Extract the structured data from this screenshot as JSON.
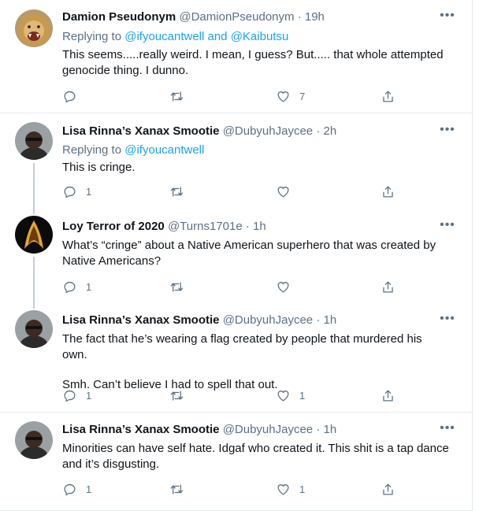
{
  "tweets": [
    {
      "name": "Damion Pseudonym",
      "handle": "@DamionPseudonym",
      "sep": "·",
      "time": "19h",
      "more": "•••",
      "replying_prefix": "Replying to ",
      "replying_to_1": "@ifyoucantwell",
      "replying_and": " and ",
      "replying_to_2": "@Kaibutsu",
      "text_line1": "This seems.....really weird. I mean, I guess? But..... that whole attempted",
      "text_line2": "genocide thing. I dunno.",
      "likes": "7"
    },
    {
      "name": "Lisa Rinna’s Xanax Smootie",
      "handle": "@DubyuhJaycee",
      "sep": "·",
      "time": "2h",
      "more": "•••",
      "replying_prefix": "Replying to ",
      "replying_to_1": "@ifyoucantwell",
      "text_line1": "This is cringe.",
      "replies": "1"
    },
    {
      "name": "Loy Terror of 2020",
      "handle": "@Turns1701e",
      "sep": "·",
      "time": "1h",
      "more": "•••",
      "text_line1": "What’s “cringe” about a Native American superhero that was created by",
      "text_line2": "Native Americans?",
      "replies": "1"
    },
    {
      "name": "Lisa Rinna’s Xanax Smootie",
      "handle": "@DubyuhJaycee",
      "sep": "·",
      "time": "1h",
      "more": "•••",
      "text_line1": "The fact that he’s wearing a flag created by people that murdered his own.",
      "text_line2": "Smh. Can’t believe I had to spell that out.",
      "replies": "1",
      "likes": "1"
    },
    {
      "name": "Lisa Rinna’s Xanax Smootie",
      "handle": "@DubyuhJaycee",
      "sep": "·",
      "time": "1h",
      "more": "•••",
      "text_line1": "Minorities can have self hate. Idgaf who created it. This shit is a tap dance",
      "text_line2": "and it’s disgusting.",
      "replies": "1",
      "likes": "1"
    }
  ]
}
